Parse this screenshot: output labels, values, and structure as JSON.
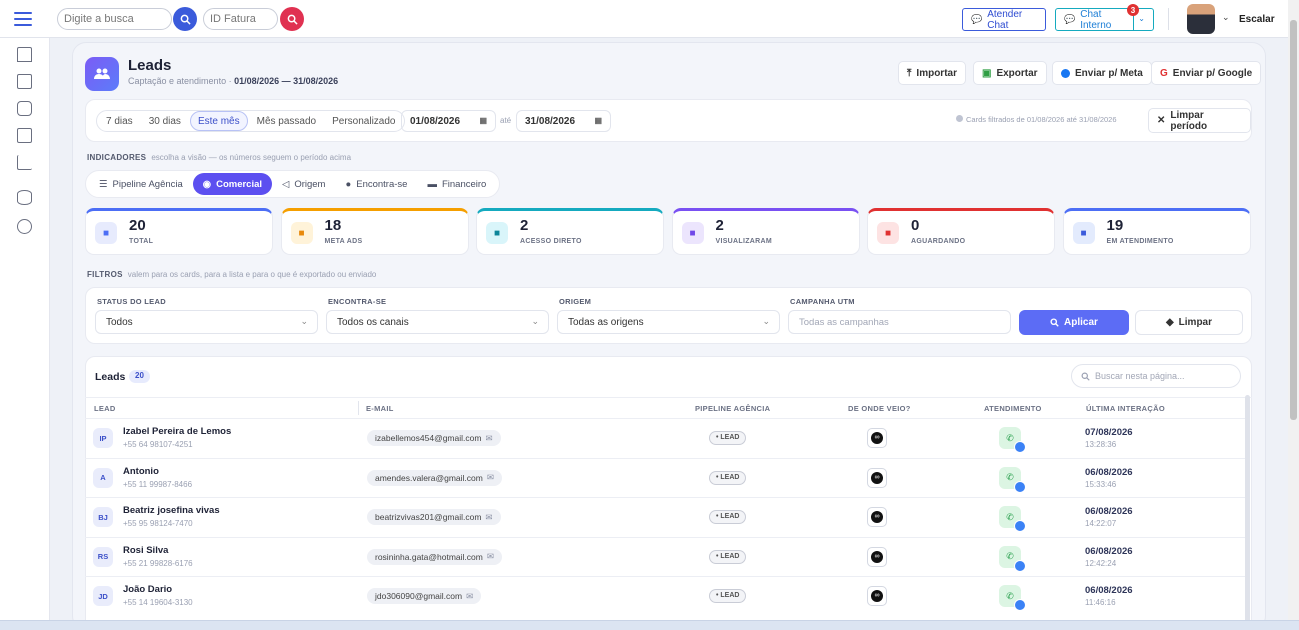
{
  "header": {
    "search_placeholder": "Digite a busca",
    "invoice_placeholder": "ID Fatura",
    "attend_chat_label": "Atender Chat",
    "internal_chat_label": "Chat Interno",
    "internal_chat_count": "3",
    "user_label": "Escalar"
  },
  "page": {
    "title": "Leads",
    "subtitle": "Captação e atendimento",
    "range": "01/08/2026 — 31/08/2026",
    "actions": [
      "Importar",
      "Exportar",
      "Enviar p/ Meta",
      "Enviar p/ Google"
    ]
  },
  "period": {
    "presets": [
      "7 dias",
      "30 dias",
      "Este mês",
      "Mês passado",
      "Personalizado"
    ],
    "active_preset": "Este mês",
    "date_from": "01/08/2026",
    "until_label": "até",
    "date_to": "31/08/2026",
    "info": "Cards filtrados de 01/08/2026 até 31/08/2026",
    "clear_label": "Limpar período"
  },
  "indicators": {
    "label": "INDICADORES",
    "hint": "escolha a visão — os números seguem o período acima",
    "tabs": [
      "Pipeline Agência",
      "Comercial",
      "Origem",
      "Encontra-se",
      "Financeiro"
    ],
    "active_tab": "Comercial",
    "kpis": [
      {
        "value": "20",
        "label": "TOTAL",
        "color": "#4c6ef5",
        "icon": "users-icon",
        "bg": "#e7ebfd",
        "fg": "#4c6ef5"
      },
      {
        "value": "18",
        "label": "META ADS",
        "color": "#f59f00",
        "icon": "chart-icon",
        "bg": "#fff3d9",
        "fg": "#e8890c"
      },
      {
        "value": "2",
        "label": "ACESSO DIRETO",
        "color": "#15aabf",
        "icon": "bolt-icon",
        "bg": "#d9f5fa",
        "fg": "#0c8599"
      },
      {
        "value": "2",
        "label": "VISUALIZARAM",
        "color": "#7950f2",
        "icon": "eye-icon",
        "bg": "#ece5fd",
        "fg": "#7048e8"
      },
      {
        "value": "0",
        "label": "AGUARDANDO",
        "color": "#e03131",
        "icon": "hourglass-icon",
        "bg": "#fde3e3",
        "fg": "#e03131"
      },
      {
        "value": "19",
        "label": "EM ATENDIMENTO",
        "color": "#4c6ef5",
        "icon": "chat-icon",
        "bg": "#e3ebfd",
        "fg": "#3b5bdb"
      }
    ]
  },
  "filters": {
    "label": "FILTROS",
    "hint": "valem para os cards, para a lista e para o que é exportado ou enviado",
    "status_label": "STATUS DO LEAD",
    "status_value": "Todos",
    "channel_label": "ENCONTRA-SE",
    "channel_value": "Todos os canais",
    "origin_label": "ORIGEM",
    "origin_value": "Todas as origens",
    "utm_label": "CAMPANHA UTM",
    "utm_placeholder": "Todas as campanhas",
    "apply_label": "Aplicar",
    "clear_label": "Limpar"
  },
  "table": {
    "title": "Leads",
    "count": "20",
    "search_placeholder": "Buscar nesta página...",
    "columns": [
      "LEAD",
      "E-MAIL",
      "PIPELINE AGÊNCIA",
      "DE ONDE VEIO?",
      "ATENDIMENTO",
      "ÚLTIMA INTERAÇÃO"
    ],
    "rows": [
      {
        "initials": "IP",
        "name": "Izabel Pereira de Lemos",
        "phone": "+55 64 98107-4251",
        "email": "izabellemos454@gmail.com",
        "pipeline": "• LEAD",
        "date": "07/08/2026",
        "time": "13:28:36"
      },
      {
        "initials": "A",
        "name": "Antonio",
        "phone": "+55 11 99987-8466",
        "email": "amendes.valera@gmail.com",
        "pipeline": "• LEAD",
        "date": "06/08/2026",
        "time": "15:33:46"
      },
      {
        "initials": "BJ",
        "name": "Beatriz josefina vivas",
        "phone": "+55 95 98124-7470",
        "email": "beatrizvivas201@gmail.com",
        "pipeline": "• LEAD",
        "date": "06/08/2026",
        "time": "14:22:07"
      },
      {
        "initials": "RS",
        "name": "Rosi Silva",
        "phone": "+55 21 99828-6176",
        "email": "rosininha.gata@hotmail.com",
        "pipeline": "• LEAD",
        "date": "06/08/2026",
        "time": "12:42:24"
      },
      {
        "initials": "JD",
        "name": "João Dario",
        "phone": "+55 14 19604-3130",
        "email": "jdo306090@gmail.com",
        "pipeline": "• LEAD",
        "date": "06/08/2026",
        "time": "11:46:16"
      }
    ]
  }
}
